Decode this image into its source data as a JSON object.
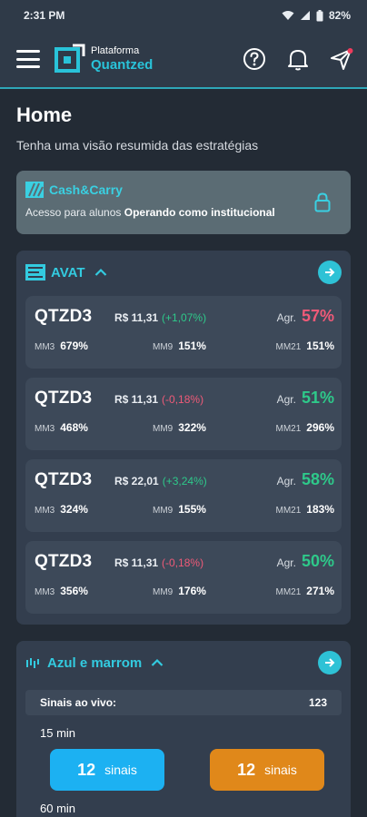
{
  "status_bar": {
    "time": "2:31 PM",
    "battery": "82%"
  },
  "app": {
    "logo_small": "Plataforma",
    "logo_big": "Quantzed"
  },
  "page": {
    "title": "Home",
    "subtitle": "Tenha uma visão resumida das estratégias"
  },
  "cash_card": {
    "title": "Cash&Carry",
    "desc_prefix": "Acesso para alunos ",
    "desc_bold": "Operando como institucional"
  },
  "avat": {
    "title": "AVAT",
    "rows": [
      {
        "ticker": "QTZD3",
        "price": "R$ 11,31",
        "change": "(+1,07%)",
        "change_dir": "pos",
        "agr_label": "Agr.",
        "agr": "57%",
        "agr_dir": "neg",
        "mm3_label": "MM3",
        "mm3": "679%",
        "mm9_label": "MM9",
        "mm9": "151%",
        "mm21_label": "MM21",
        "mm21": "151%"
      },
      {
        "ticker": "QTZD3",
        "price": "R$ 11,31",
        "change": "(-0,18%)",
        "change_dir": "neg",
        "agr_label": "Agr.",
        "agr": "51%",
        "agr_dir": "pos",
        "mm3_label": "MM3",
        "mm3": "468%",
        "mm9_label": "MM9",
        "mm9": "322%",
        "mm21_label": "MM21",
        "mm21": "296%"
      },
      {
        "ticker": "QTZD3",
        "price": "R$ 22,01",
        "change": "(+3,24%)",
        "change_dir": "pos",
        "agr_label": "Agr.",
        "agr": "58%",
        "agr_dir": "pos",
        "mm3_label": "MM3",
        "mm3": "324%",
        "mm9_label": "MM9",
        "mm9": "155%",
        "mm21_label": "MM21",
        "mm21": "183%"
      },
      {
        "ticker": "QTZD3",
        "price": "R$ 11,31",
        "change": "(-0,18%)",
        "change_dir": "neg",
        "agr_label": "Agr.",
        "agr": "50%",
        "agr_dir": "pos",
        "mm3_label": "MM3",
        "mm3": "356%",
        "mm9_label": "MM9",
        "mm9": "176%",
        "mm21_label": "MM21",
        "mm21": "271%"
      }
    ]
  },
  "azul": {
    "title": "Azul e marrom",
    "signals_label": "Sinais ao vivo:",
    "signals_count": "123",
    "tf1": "15 min",
    "btn_buy_num": "12",
    "btn_buy_txt": "sinais",
    "btn_sell_num": "12",
    "btn_sell_txt": "sinais",
    "tf2": "60 min"
  },
  "colors": {
    "accent": "#2ec2d6",
    "positive": "#2ec98a",
    "negative": "#ef5a78",
    "buy": "#1cb1f2",
    "sell": "#e0881a"
  }
}
